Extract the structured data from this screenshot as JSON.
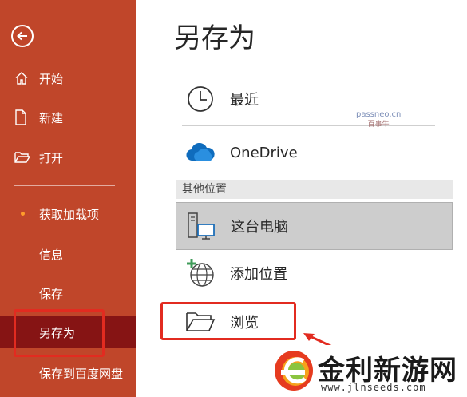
{
  "sidebar": {
    "back_label": "back",
    "items": [
      {
        "label": "开始"
      },
      {
        "label": "新建"
      },
      {
        "label": "打开"
      },
      {
        "label": "获取加载项"
      },
      {
        "label": "信息"
      },
      {
        "label": "保存"
      },
      {
        "label": "另存为"
      },
      {
        "label": "保存到百度网盘"
      }
    ],
    "active_index": 6
  },
  "main": {
    "title": "另存为",
    "locations": [
      {
        "label": "最近",
        "icon": "clock-icon"
      },
      {
        "label": "OneDrive",
        "icon": "cloud-icon"
      }
    ],
    "section_header": "其他位置",
    "other_locations": [
      {
        "label": "这台电脑",
        "icon": "computer-icon",
        "selected": true
      },
      {
        "label": "添加位置",
        "icon": "add-globe-icon"
      },
      {
        "label": "浏览",
        "icon": "folder-icon"
      }
    ]
  },
  "watermark": {
    "line1": "passneo.cn",
    "line2": "百事牛"
  },
  "logo": {
    "name": "金利新游网",
    "url": "www.jlnseeds.com"
  },
  "colors": {
    "sidebar": "#c0462a",
    "active": "#861414",
    "highlight_box": "#e22b20",
    "onedrive": "#0f6cbd"
  }
}
